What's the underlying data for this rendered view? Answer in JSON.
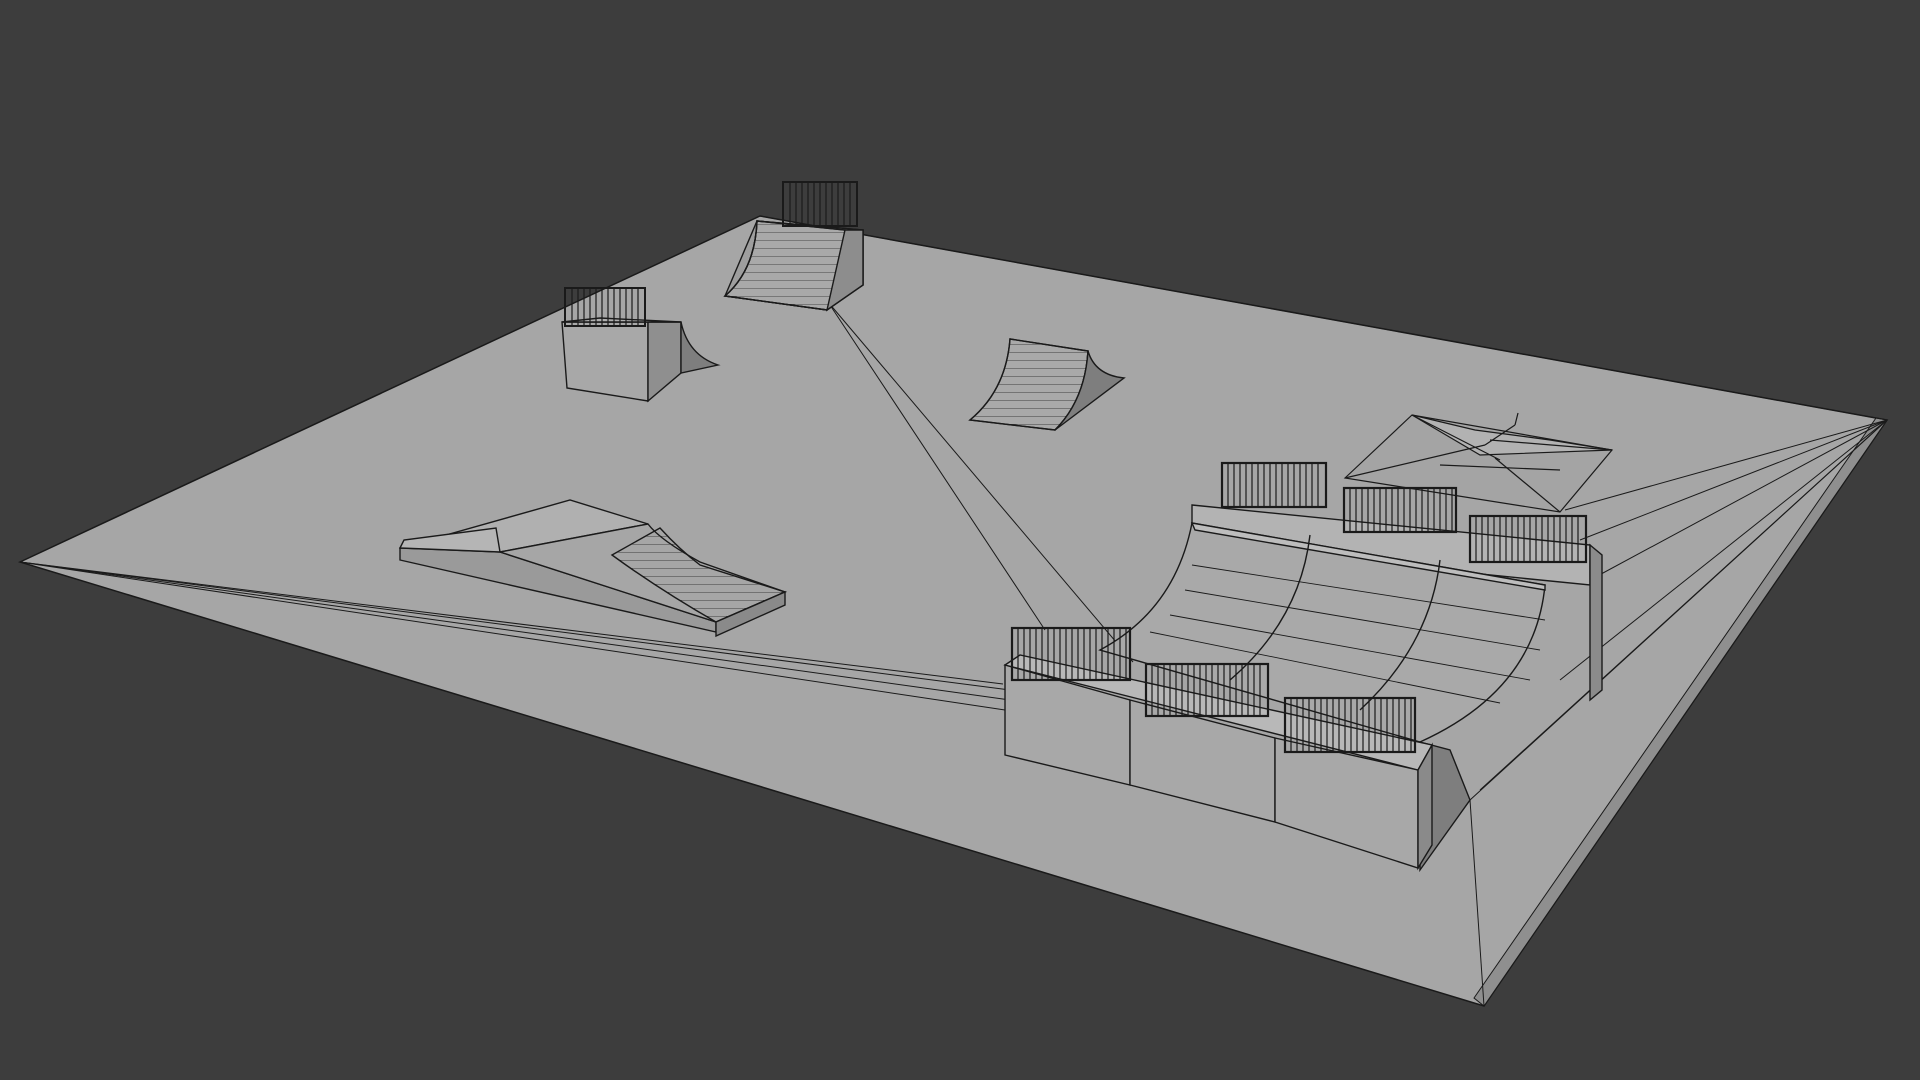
{
  "viewport": {
    "background_color": "#3d3d3d",
    "shading": "solid-gray-with-wireframe",
    "surface_color": "#a8a8a8",
    "side_color": "#8f8f8f",
    "shadow_color": "#7c7c7c",
    "wire_color": "#1a1a1a",
    "objects": [
      "ground-plane",
      "quarter-pipe-back",
      "small-box-ramp",
      "center-quarter-pipe",
      "funbox-ramp",
      "gazebo-roof",
      "mini-ramp-complex"
    ]
  }
}
